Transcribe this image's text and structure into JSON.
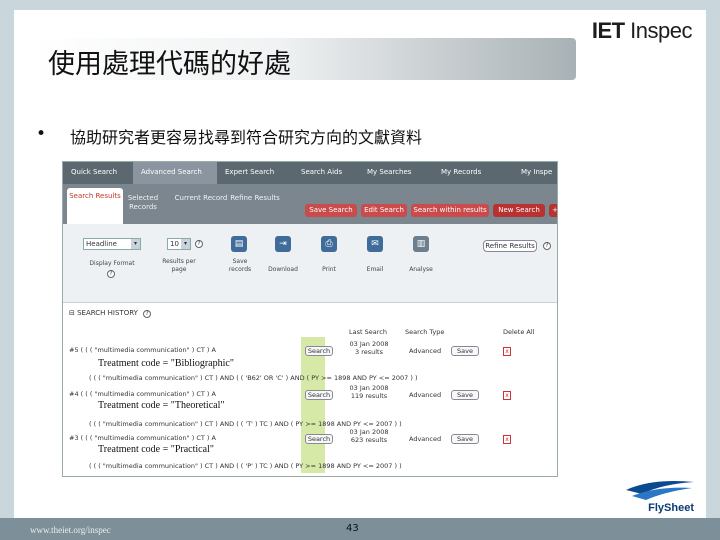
{
  "brand": {
    "part1": "IET",
    "part2": " Inspec"
  },
  "slide": {
    "title": "使用處理代碼的好處",
    "bullet_mark": "•",
    "bullet_text": "協助研究者更容易找尋到符合研究方向的文獻資料",
    "footer_url": "www.theiet.org/inspec",
    "page_number": "43",
    "logo_text": "FlySheet"
  },
  "screenshot": {
    "nav_tabs": [
      "Quick Search",
      "Advanced Search",
      "Expert Search",
      "Search Aids",
      "My Searches",
      "My Records",
      "My Inspe"
    ],
    "sub_tabs": [
      "Search Results",
      "Selected Records",
      "Current Record",
      "Refine Results"
    ],
    "sub_buttons": [
      "Save Search",
      "Edit Search",
      "Search within results",
      "New Search",
      "+"
    ],
    "display_format": {
      "value": "Headline",
      "label": "Display Format"
    },
    "results_per_page": {
      "value": "10",
      "label": "Results per page"
    },
    "tools": [
      "Save records",
      "Download",
      "Print",
      "Email",
      "Analyse"
    ],
    "refine_button": "Refine Results",
    "history_title": "SEARCH HISTORY",
    "columns": [
      "Last Search",
      "Search Type",
      "Delete All"
    ],
    "rows": [
      {
        "id": "#5",
        "query": "( ( ( \"multimedia communication\" ) CT ) A",
        "detail": "( ( ( \"multimedia communication\" ) CT ) AND ( ( 'B62' OR 'C' ) AND ( PY >= 1898 AND PY <= 2007 ) )",
        "date": "03 Jan 2008",
        "results": "3 results",
        "type": "Advanced",
        "treatment": "Treatment code = \"Bibliographic\""
      },
      {
        "id": "#4",
        "query": "( ( ( \"multimedia communication\" ) CT ) A",
        "detail": "( ( ( \"multimedia communication\" ) CT ) AND ( ( 'T' ) TC ) AND ( PY >= 1898 AND PY <= 2007 ) )",
        "date": "03 Jan 2008",
        "results": "119 results",
        "type": "Advanced",
        "treatment": "Treatment code = \"Theoretical\""
      },
      {
        "id": "#3",
        "query": "( ( ( \"multimedia communication\" ) CT ) A",
        "detail": "( ( ( \"multimedia communication\" ) CT ) AND ( ( 'P' ) TC ) AND ( PY >= 1898 AND PY <= 2007 ) )",
        "date": "03 Jan 2008",
        "results": "623 results",
        "type": "Advanced",
        "treatment": "Treatment code = \"Practical\""
      }
    ],
    "rerun_label": "Search",
    "save_label": "Save"
  }
}
